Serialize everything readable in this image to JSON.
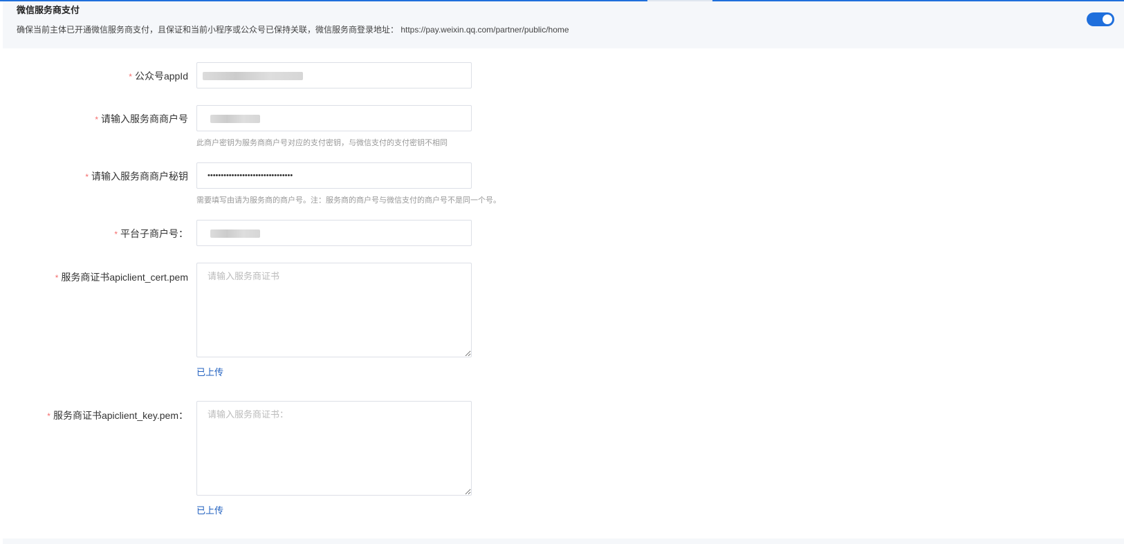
{
  "header": {
    "title": "微信服务商支付",
    "description": "确保当前主体已开通微信服务商支付，且保证和当前小程序或公众号已保持关联，微信服务商登录地址： https://pay.weixin.qq.com/partner/public/home",
    "toggle_on": true,
    "accent_color": "#1f6fdc"
  },
  "form": {
    "required_mark": "*",
    "appid": {
      "label": "公众号appId"
    },
    "merchant_id": {
      "label": "请输入服务商商户号",
      "hint": "此商户密钥为服务商商户号对应的支付密钥，与微信支付的支付密钥不相同"
    },
    "merchant_secret": {
      "label": "请输入服务商商户秘钥",
      "value": "••••••••••••••••••••••••••••••••",
      "hint": "需要填写由请为服务商的商户号。注：服务商的商户号与微信支付的商户号不是同一个号。"
    },
    "sub_merchant": {
      "label": "平台子商户号："
    },
    "cert": {
      "label": "服务商证书apiclient_cert.pem",
      "placeholder": "请输入服务商证书",
      "status": "已上传"
    },
    "key": {
      "label": "服务商证书apiclient_key.pem：",
      "placeholder": "请输入服务商证书：",
      "status": "已上传"
    }
  }
}
